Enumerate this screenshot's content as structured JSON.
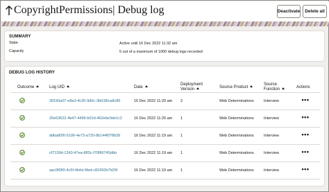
{
  "header": {
    "title": "CopyrightPermissions| Debug log",
    "deactivate_label": "Deactivate",
    "delete_all_label": "Delete all"
  },
  "summary": {
    "heading": "SUMMARY",
    "state_label": "State",
    "state_value": "Active until 16 Dec 2022 11:32 am",
    "capacity_label": "Capacity",
    "capacity_value": "5 out of a maximum of 1000 debug logs recorded"
  },
  "history": {
    "heading": "DEBUG LOG HISTORY",
    "columns": {
      "outcome": "Outcome",
      "log_uid": "Log UID",
      "date": "Date",
      "deployment_version_1": "Deployment",
      "deployment_version_2": "Version",
      "source_product": "Source Product",
      "source_function_1": "Source",
      "source_function_2": "Function",
      "actions": "Actions"
    },
    "rows": [
      {
        "outcome": "success",
        "log_uid": "39190a07-e8a3-4c35-9d0c-3fd196ca8c85",
        "date": "16 Dec 2022 11:20 am",
        "version": "2",
        "source_product": "Web Determinations",
        "source_function": "Interview",
        "actions": "•••"
      },
      {
        "outcome": "success",
        "log_uid": "26e63622-4b47-4499-b01d-462ebe3de1c2",
        "date": "16 Dec 2022 11:20 am",
        "version": "1",
        "source_product": "Web Determinations",
        "source_function": "Interview",
        "actions": "•••"
      },
      {
        "outcome": "success",
        "log_uid": "ddba80f0-5106-4e73-a720-8b144f078b39",
        "date": "16 Dec 2022 11:19 am",
        "version": "1",
        "source_product": "Web Determinations",
        "source_function": "Interview",
        "actions": "•••"
      },
      {
        "outcome": "success",
        "log_uid": "cf7139d-1243-47ea-883c-f70f66745dbb",
        "date": "16 Dec 2022 11:19 am",
        "version": "1",
        "source_product": "Web Determinations",
        "source_function": "Interview",
        "actions": "•••"
      },
      {
        "outcome": "success",
        "log_uid": "aac0f080-4c5f-4b4d-9fed-c82492b7b25f",
        "date": "16 Dec 2022 11:19 am",
        "version": "1",
        "source_product": "Web Determinations",
        "source_function": "Interview",
        "actions": "•••"
      }
    ]
  },
  "colors": {
    "link": "#2a6f8f",
    "success": "#508223",
    "background": "#f1efed"
  },
  "icons": {
    "back": "back-arrow-icon",
    "outcome": "check-circle-icon",
    "actions": "more-horizontal-icon"
  }
}
